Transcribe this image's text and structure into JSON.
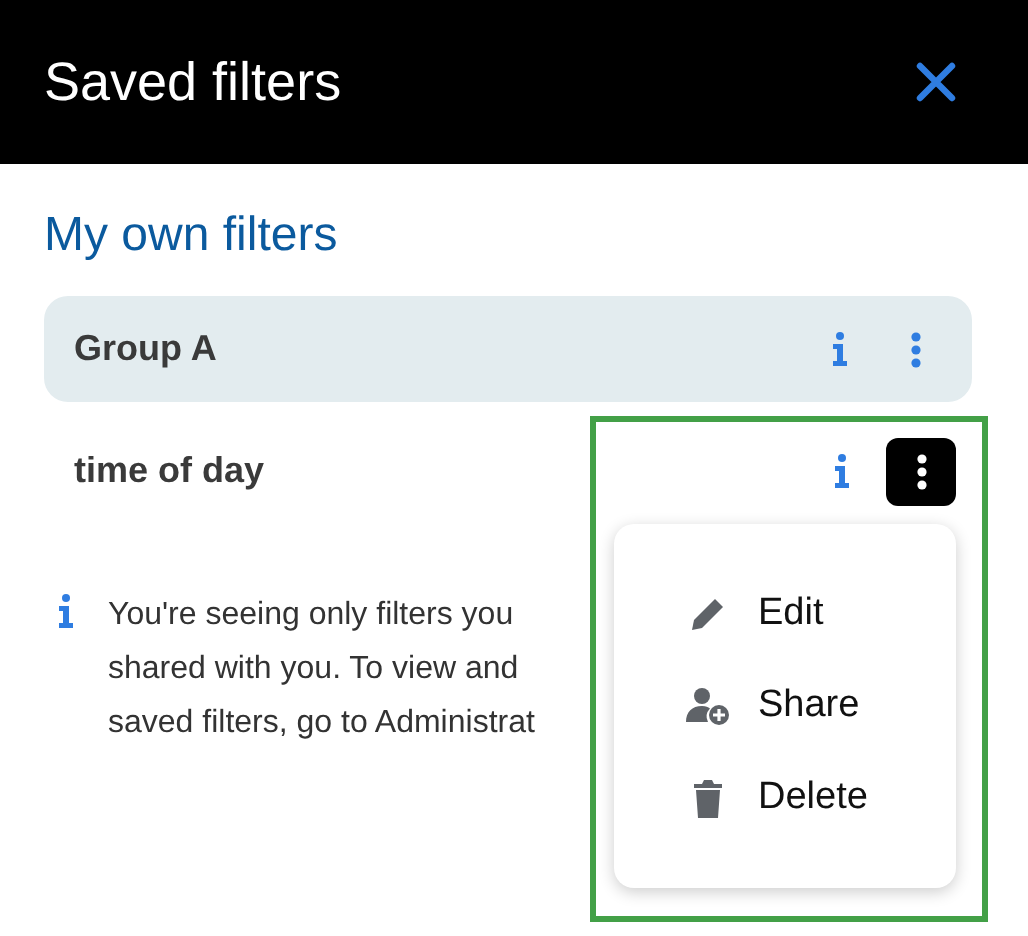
{
  "header": {
    "title": "Saved filters"
  },
  "section": {
    "title": "My own filters"
  },
  "filters": [
    {
      "name": "Group A",
      "selected": true,
      "menu_open": false
    },
    {
      "name": "time of day",
      "selected": false,
      "menu_open": true
    }
  ],
  "info": {
    "lines": [
      "You're seeing only filters you",
      "shared with you. To view and",
      "saved filters, go to Administrat"
    ]
  },
  "menu": {
    "items": [
      {
        "kind": "edit",
        "label": "Edit"
      },
      {
        "kind": "share",
        "label": "Share"
      },
      {
        "kind": "delete",
        "label": "Delete"
      }
    ]
  }
}
